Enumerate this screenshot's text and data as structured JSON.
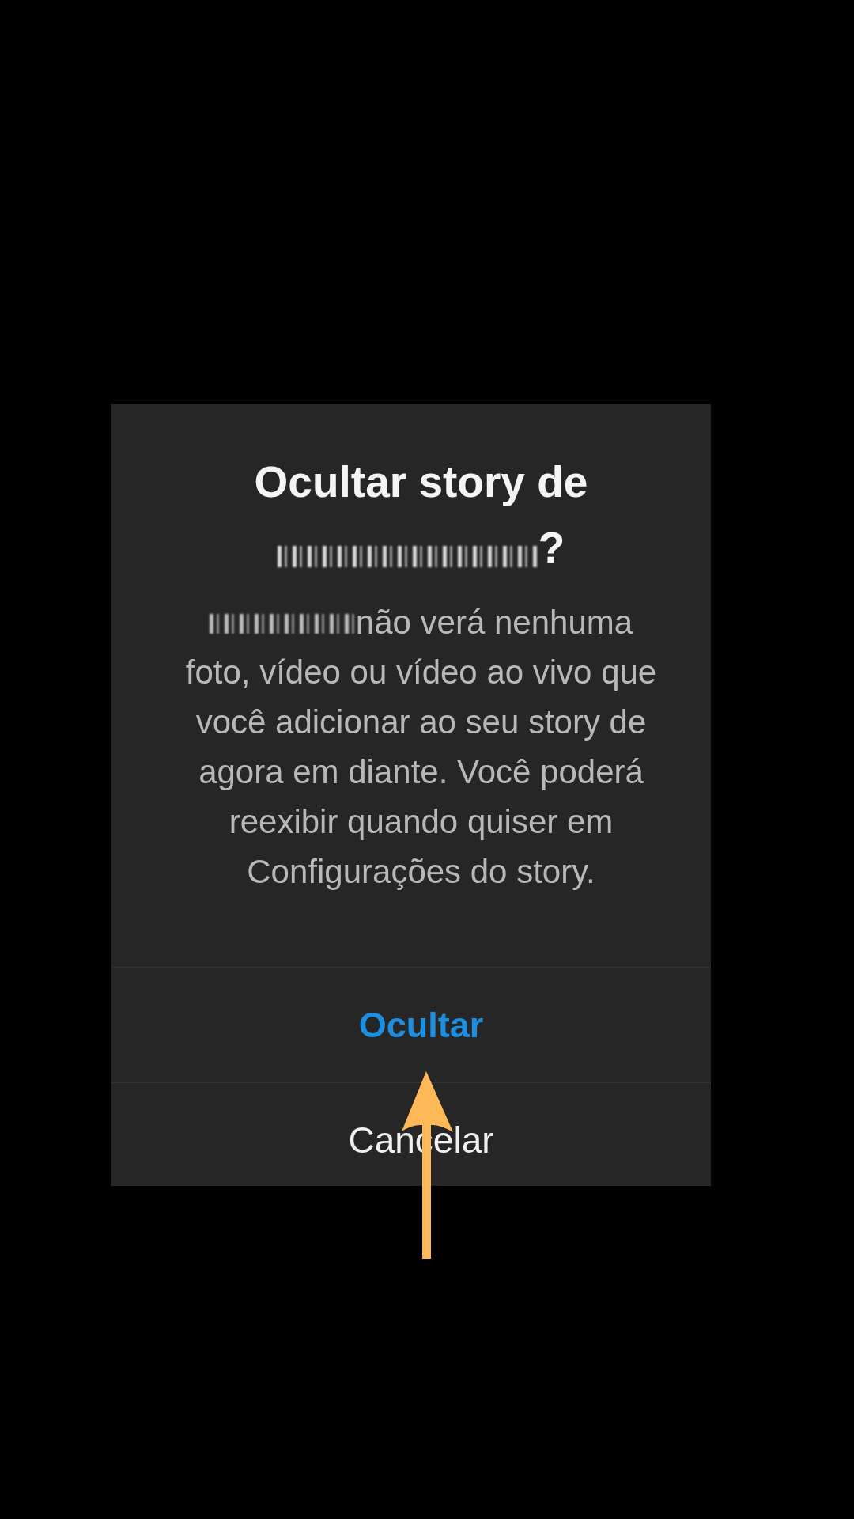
{
  "dialog": {
    "title": "Ocultar story de",
    "title_name_redacted": true,
    "title_end": "?",
    "message_name_redacted": true,
    "message": "não verá nenhuma foto, vídeo ou vídeo ao vivo que você adicionar ao seu story de agora em diante. Você poderá reexibir quando quiser em Configurações do story."
  },
  "actions": [
    {
      "label": "Ocultar",
      "kind": "primary"
    },
    {
      "label": "Cancelar",
      "kind": "secondary"
    }
  ],
  "annotation": {
    "kind": "arrow"
  }
}
